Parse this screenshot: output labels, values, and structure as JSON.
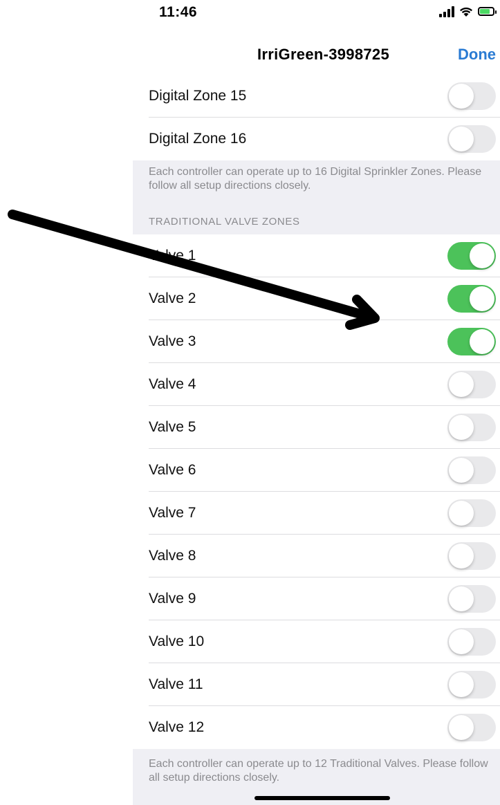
{
  "status_bar": {
    "time": "11:46"
  },
  "nav": {
    "title": "IrriGreen-3998725",
    "done_label": "Done"
  },
  "digital_zones": [
    {
      "label": "Digital Zone 15",
      "on": false
    },
    {
      "label": "Digital Zone 16",
      "on": false
    }
  ],
  "digital_footer": "Each controller can operate up to 16 Digital Sprinkler Zones. Please follow all setup directions closely.",
  "valve_section_header": "TRADITIONAL VALVE ZONES",
  "valves": [
    {
      "label": "Valve 1",
      "on": true
    },
    {
      "label": "Valve 2",
      "on": true
    },
    {
      "label": "Valve 3",
      "on": true
    },
    {
      "label": "Valve 4",
      "on": false
    },
    {
      "label": "Valve 5",
      "on": false
    },
    {
      "label": "Valve 6",
      "on": false
    },
    {
      "label": "Valve 7",
      "on": false
    },
    {
      "label": "Valve 8",
      "on": false
    },
    {
      "label": "Valve 9",
      "on": false
    },
    {
      "label": "Valve 10",
      "on": false
    },
    {
      "label": "Valve 11",
      "on": false
    },
    {
      "label": "Valve 12",
      "on": false
    }
  ],
  "valve_footer": "Each controller can operate up to 12 Traditional Valves. Please follow all setup directions closely.",
  "colors": {
    "toggle_on": "#4cc25a",
    "toggle_off": "#e9e9eb",
    "accent": "#2a7bd3",
    "group_background": "#efeff4"
  }
}
